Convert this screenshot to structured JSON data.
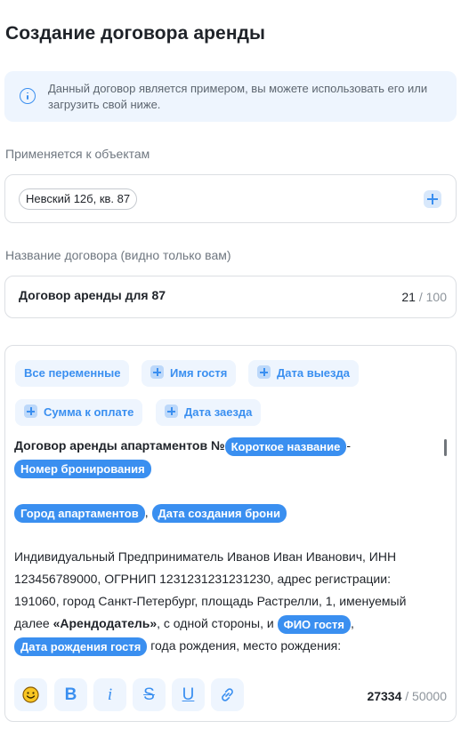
{
  "page": {
    "title": "Создание договора аренды"
  },
  "info": {
    "text": "Данный договор является примером, вы можете использовать его или загрузить свой ниже.",
    "icon": "info-icon"
  },
  "objects": {
    "label": "Применяется к объектам",
    "chip": "Невский 12б, кв. 87",
    "add_icon": "plus-icon"
  },
  "name_field": {
    "label": "Название договора (видно только вам)",
    "value": "Договор аренды для 87",
    "count": "21",
    "max": "/ 100"
  },
  "variables": {
    "all": "Все переменные",
    "guest_name": "Имя гостя",
    "checkout_date": "Дата выезда",
    "amount_due": "Сумма к оплате",
    "checkin_date": "Дата заезда"
  },
  "contract": {
    "line1_prefix": "Договор аренды апартаментов №",
    "tok_short_name": "Короткое название",
    "dash": "-",
    "tok_booking_number": "Номер бронирования",
    "tok_city": "Город апартаментов",
    "comma": ",",
    "tok_booking_date": "Дата создания брони",
    "para3_text": "Индивидуальный Предприниматель Иванов Иван Иванович, ИНН 123456789000, ОГРНИП 1231231231231230, адрес регистрации: 191060, город Санкт-Петербург, площадь Растрелли, 1, именуемый далее ",
    "landlord": "«Арендодатель»",
    "para3_mid": ", с одной стороны, и ",
    "tok_guest_fullname": "ФИО гостя",
    "comma2": ",",
    "tok_guest_birthdate": "Дата рождения гостя",
    "para3_end": " года рождения, место рождения:"
  },
  "toolbar": {
    "emoji_icon": "emoji-icon",
    "bold_label": "B",
    "italic_label": "i",
    "strike_label": "S",
    "underline_label": "U",
    "link_icon": "link-icon",
    "count": "27334",
    "max": "/ 50000"
  },
  "colors": {
    "accent": "#3a8ff0",
    "accent_soft": "#eef5fe",
    "text": "#1f2329",
    "muted": "#6f7780",
    "border": "#dcdfe3"
  }
}
